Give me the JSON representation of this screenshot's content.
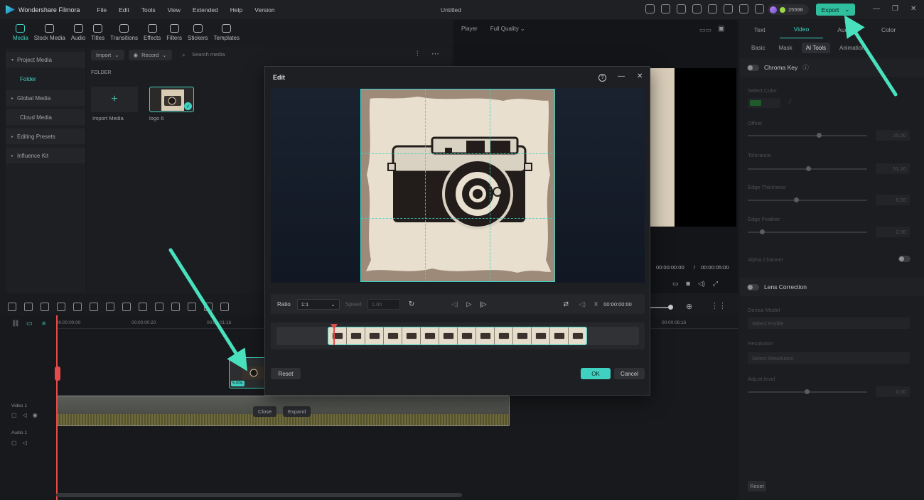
{
  "app": {
    "name": "Wondershare Filmora",
    "doc_title": "Untitled",
    "menu": [
      "File",
      "Edit",
      "Tools",
      "View",
      "Extended",
      "Help",
      "Version"
    ],
    "credits": "25596",
    "export_label": "Export"
  },
  "toolbar": {
    "items": [
      "Media",
      "Stock Media",
      "Audio",
      "Titles",
      "Transitions",
      "Effects",
      "Filters",
      "Stickers",
      "Templates"
    ]
  },
  "leftnav": {
    "project_media": "Project Media",
    "folder": "Folder",
    "global_media": "Global Media",
    "cloud_media": "Cloud Media",
    "editing_presets": "Editing Presets",
    "influence_kit": "Influence Kit"
  },
  "mediapane": {
    "import_label": "Import",
    "record_label": "Record",
    "search_placeholder": "Search media",
    "folder_label": "FOLDER",
    "import_media_label": "Import Media",
    "media_name": "logo 6"
  },
  "player": {
    "label": "Player",
    "quality": "Full Quality",
    "current_time": "00:00:00:00",
    "separator": "/",
    "total_time": "00:00:05:00"
  },
  "rightpanel": {
    "tabs": [
      "Text",
      "Video",
      "Audio",
      "Color"
    ],
    "subtabs": [
      "Basic",
      "Mask",
      "AI Tools",
      "Animation"
    ],
    "chroma_key": "Chroma Key",
    "select_color": "Select Color",
    "offset_label": "Offset",
    "offset_value": "25.00",
    "tolerance_label": "Tolerance",
    "tolerance_value": "51.20",
    "edge_thickness_label": "Edge Thickness",
    "edge_thickness_value": "0.00",
    "edge_feather_label": "Edge Feather",
    "edge_feather_value": "2.00",
    "alpha_channel": "Alpha Channel",
    "lens_correction": "Lens Correction",
    "device_model": "Device Model",
    "select_profile": "Select Profile",
    "resolution": "Resolution",
    "select_resolution": "Select Resolution",
    "adjust_level": "Adjust level",
    "adjust_value": "0.00",
    "reset": "Reset"
  },
  "timeline": {
    "ruler": [
      "00:00:00:00",
      "00:00:00:20",
      "00:00:01:16",
      "00:00:06:16"
    ],
    "video_track": "Video 1",
    "audio_track": "Audio 1",
    "close_label": "Close",
    "expand_label": "Expand",
    "drag_badge": "5.00s"
  },
  "dialog": {
    "title": "Edit",
    "help": "?",
    "ratio_label": "Ratio",
    "ratio_value": "1:1",
    "speed_label": "Speed",
    "speed_value": "1.00",
    "timecode": "00:00:00:00",
    "reset": "Reset",
    "ok": "OK",
    "cancel": "Cancel"
  },
  "colors": {
    "accent": "#3fd2c3",
    "playhead": "#e74a4a",
    "export_bg": "#2fbf9f",
    "arrow": "#49e0be"
  }
}
